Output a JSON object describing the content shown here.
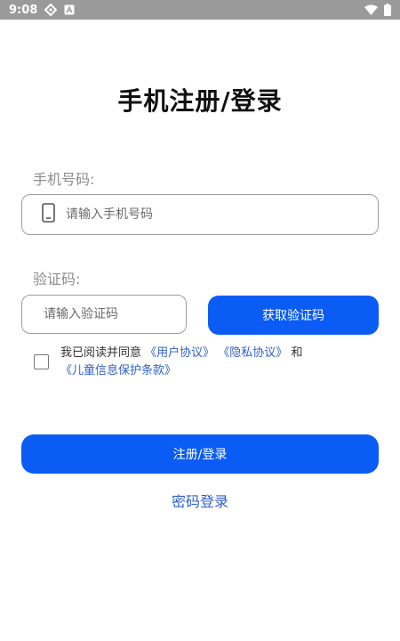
{
  "status_bar": {
    "time": "9:08",
    "icons": [
      "sync-icon",
      "a-notification-icon",
      "wifi-icon",
      "battery-icon"
    ]
  },
  "page": {
    "title": "手机注册/登录"
  },
  "phone": {
    "label": "手机号码:",
    "placeholder": "请输入手机号码",
    "value": ""
  },
  "code": {
    "label": "验证码:",
    "placeholder": "请输入验证码",
    "value": "",
    "get_code_label": "获取验证码"
  },
  "agreement": {
    "checked": false,
    "prefix": "我已阅读并同意 ",
    "user_agreement": "《用户协议》",
    "privacy_policy": "《隐私协议》",
    "conjunction": "和",
    "children_policy": "《儿童信息保护条款》"
  },
  "actions": {
    "submit_label": "注册/登录",
    "password_login_label": "密码登录"
  },
  "colors": {
    "primary": "#0a5cf5",
    "link": "#2f5fd0",
    "status_bar": "#9a9a9a"
  }
}
